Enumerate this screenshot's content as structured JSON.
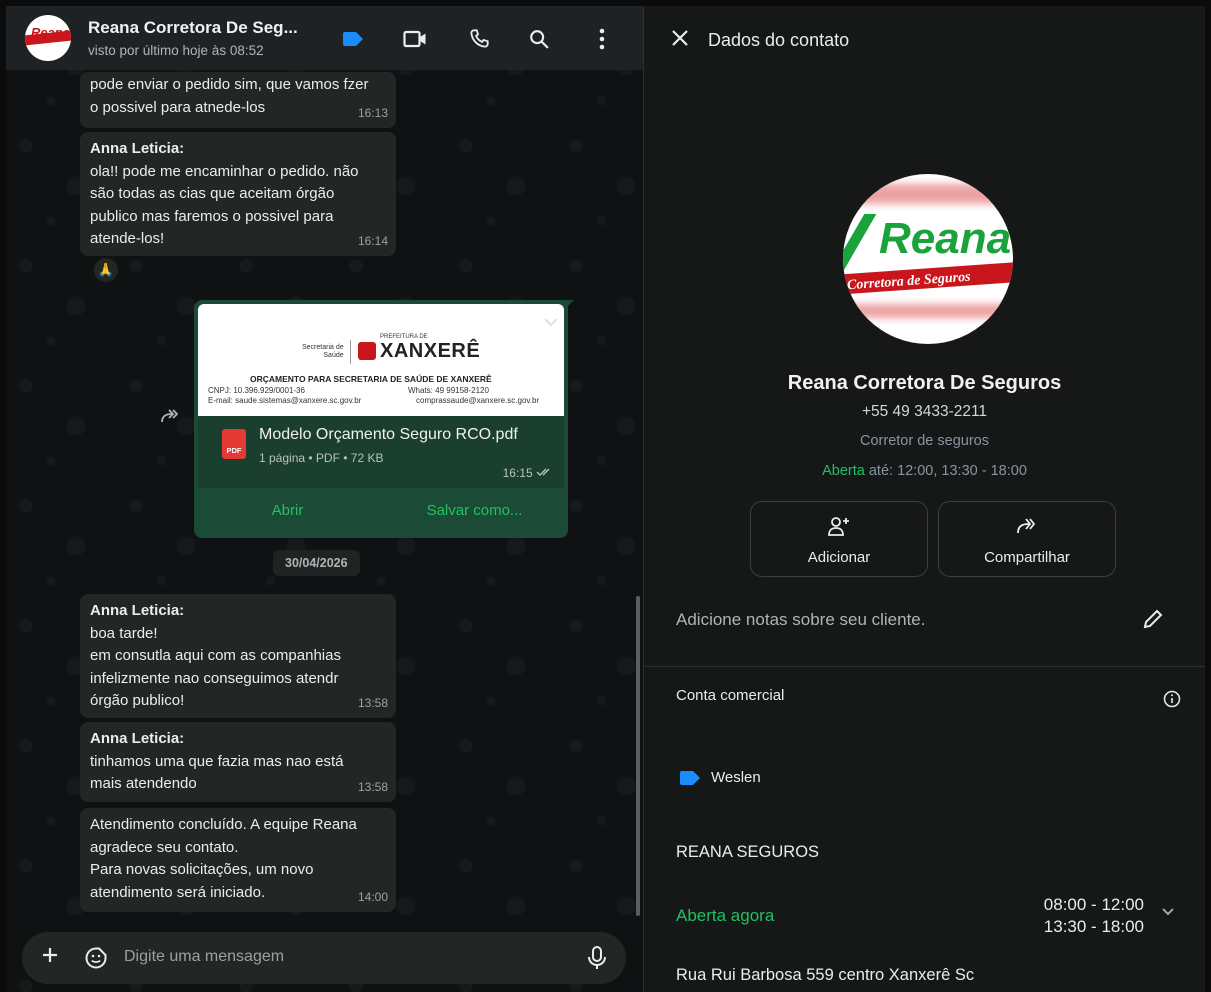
{
  "chat": {
    "header": {
      "title": "Reana Corretora De Seg...",
      "subtitle": "visto por último hoje às 08:52",
      "avatar_text": "Reana",
      "avatar_sub": "Corretora de Seguros"
    },
    "messages": [
      {
        "sender": "",
        "text": "pode enviar o pedido sim, que vamos fzer\no possivel para atnede-los",
        "time": "16:13"
      },
      {
        "sender": "Anna Leticia:",
        "text": "ola!! pode me encaminhar o pedido. não\nsão todas as cias que aceitam órgão\npublico mas faremos o possivel para\natende-los!",
        "time": "16:14"
      },
      {
        "sender": "Anna Leticia:",
        "text": "boa tarde!\nem consutla aqui com as companhias\ninfelizmente nao conseguimos atendr\nórgão publico!",
        "time": "13:58"
      },
      {
        "sender": "Anna Leticia:",
        "text": "tinhamos uma que fazia mas nao está\nmais atendendo",
        "time": "13:58"
      },
      {
        "sender": "",
        "text": "Atendimento concluído. A equipe Reana\nagradece seu contato.\nPara novas solicitações, um novo\natendimento será iniciado.",
        "time": "14:00"
      }
    ],
    "reaction": "🙏",
    "document": {
      "preview": {
        "secretaria": "Secretaria de\nSaúde",
        "prefeitura": "PREFEITURA DE",
        "city": "XANXERÊ",
        "title": "ORÇAMENTO PARA SECRETARIA DE SAÚDE DE XANXERÊ",
        "cnpj": "CNPJ:   10.396.929/0001-36",
        "email": "E-mail:   saude.sistemas@xanxere.sc.gov.br",
        "whats": "Whats:  49 99158-2120",
        "email2": "comprassaude@xanxere.sc.gov.br"
      },
      "filename": "Modelo Orçamento Seguro RCO.pdf",
      "meta": "1 página • PDF • 72 KB",
      "time": "16:15",
      "pdf_badge": "PDF",
      "open_label": "Abrir",
      "save_label": "Salvar como..."
    },
    "date_chip": "30/04/2026",
    "composer": {
      "placeholder": "Digite uma mensagem"
    }
  },
  "contact": {
    "panel_title": "Dados do contato",
    "avatar_brand": "Reana",
    "avatar_sub": "Corretora de Seguros",
    "name": "Reana Corretora De Seguros",
    "phone": "+55 49 3433-2211",
    "category": "Corretor de seguros",
    "hours_status": "Aberta",
    "hours_text": " até: 12:00, 13:30 - 18:00",
    "actions": {
      "add": "Adicionar",
      "share": "Compartilhar"
    },
    "notes_placeholder": "Adicione notas sobre seu cliente.",
    "business_label": "Conta comercial",
    "tag": "Weslen",
    "business_name": "REANA SEGUROS",
    "open_now": "Aberta agora",
    "hours_1": "08:00 - 12:00",
    "hours_2": "13:30 - 18:00",
    "address": "Rua Rui Barbosa 559 centro Xanxerê Sc"
  },
  "colors": {
    "accent_green": "#21c063",
    "tag_blue": "#1a8cff",
    "brand_red": "#c9161c",
    "brand_green": "#1aa33a"
  }
}
